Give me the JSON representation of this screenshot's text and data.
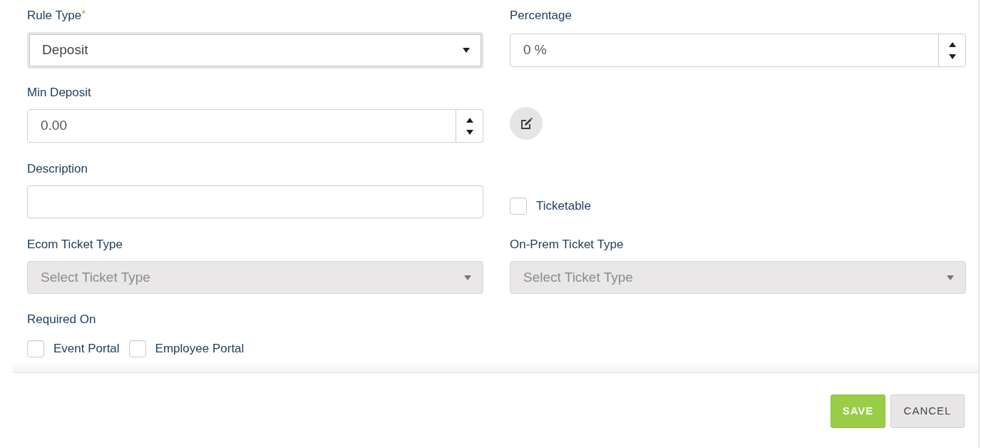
{
  "rule_type": {
    "label": "Rule Type",
    "required_mark": "*",
    "value": "Deposit",
    "focused": true
  },
  "percentage": {
    "label": "Percentage",
    "value": "0 %"
  },
  "min_deposit": {
    "label": "Min Deposit",
    "value": "0.00"
  },
  "description": {
    "label": "Description"
  },
  "ticketable": {
    "label": "Ticketable",
    "checked": false
  },
  "ecom_ticket_type": {
    "label": "Ecom Ticket Type",
    "placeholder": "Select Ticket Type",
    "disabled": true
  },
  "on_prem_ticket_type": {
    "label": "On-Prem Ticket Type",
    "placeholder": "Select Ticket Type",
    "disabled": true
  },
  "required_on": {
    "label": "Required On",
    "options": [
      {
        "label": "Event Portal",
        "checked": false
      },
      {
        "label": "Employee Portal",
        "checked": false
      }
    ]
  },
  "buttons": [
    {
      "label": "SAVE",
      "kind": "primary"
    },
    {
      "label": "CANCEL",
      "kind": "secondary"
    }
  ]
}
